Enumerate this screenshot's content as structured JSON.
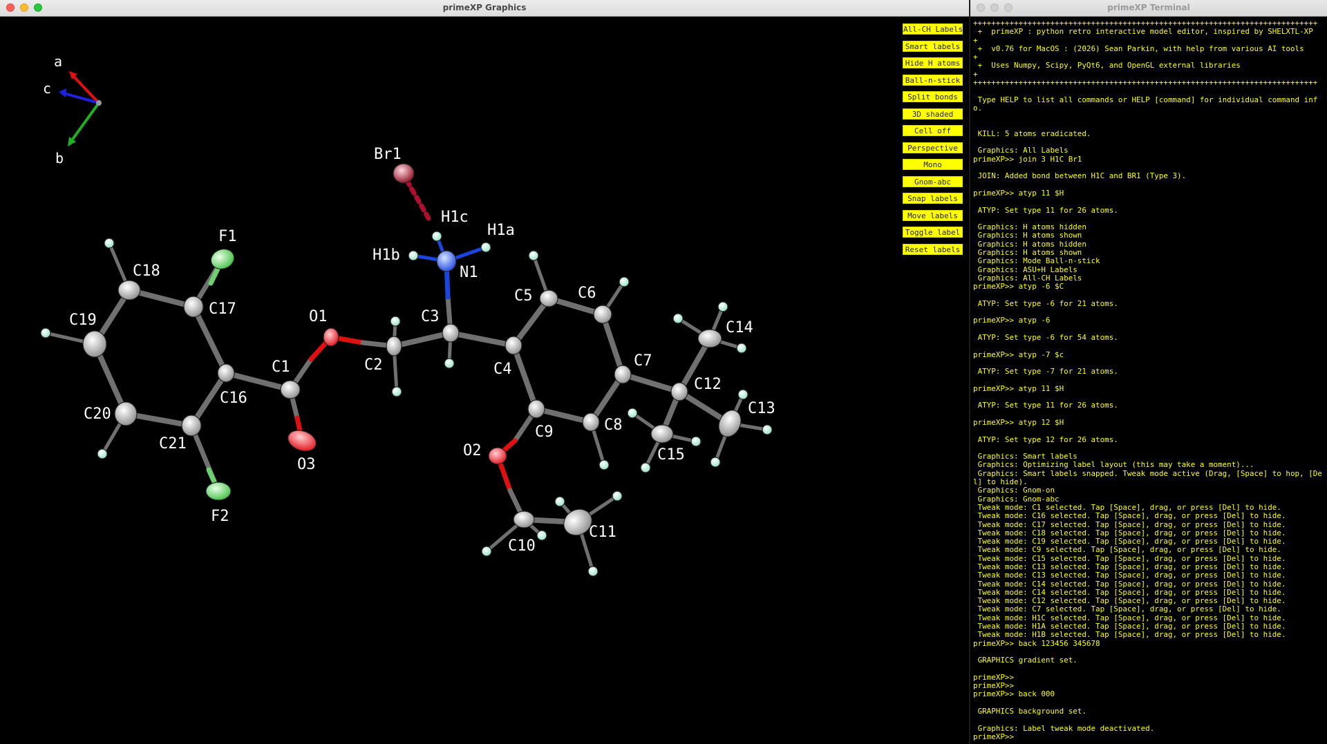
{
  "graphics_window": {
    "title": "primeXP Graphics",
    "axes": {
      "a": "a",
      "b": "b",
      "c": "c"
    },
    "buttons": [
      "All-CH Labels",
      "Smart labels",
      "Hide H atoms",
      "Ball-n-stick",
      "Split bonds",
      "3D shaded",
      "Cell off",
      "Perspective",
      "Mono",
      "Gnom-abc",
      "Snap labels",
      "Move labels",
      "Toggle label",
      "Reset labels"
    ],
    "atom_labels": {
      "Br1": "Br1",
      "H1c": "H1c",
      "H1a": "H1a",
      "H1b": "H1b",
      "N1": "N1",
      "F1": "F1",
      "F2": "F2",
      "O1": "O1",
      "O2": "O2",
      "O3": "O3",
      "C1": "C1",
      "C2": "C2",
      "C3": "C3",
      "C4": "C4",
      "C5": "C5",
      "C6": "C6",
      "C7": "C7",
      "C8": "C8",
      "C9": "C9",
      "C10": "C10",
      "C11": "C11",
      "C12": "C12",
      "C13": "C13",
      "C14": "C14",
      "C15": "C15",
      "C16": "C16",
      "C17": "C17",
      "C18": "C18",
      "C19": "C19",
      "C20": "C20",
      "C21": "C21"
    },
    "colors": {
      "background": "#000000",
      "carbon": "#e8e8e8",
      "oxygen": "#ff2a2a",
      "nitrogen": "#2a5cff",
      "fluorine": "#8aff8a",
      "bromine": "#a8142a",
      "hydrogen": "#b8ffe8",
      "bond": "#707070"
    }
  },
  "terminal_window": {
    "title": "primeXP Terminal",
    "lines": [
      "++++++++++++++++++++++++++++++++++++++++++++++++++++++++++++++++++++++++++++",
      " +  primeXP : python retro interactive model editor, inspired by SHELXTL-XP  +",
      " +  v0.76 for MacOS : (2026) Sean Parkin, with help from various AI tools    +",
      " +  Uses Numpy, Scipy, PyQt6, and OpenGL external libraries                  +",
      "++++++++++++++++++++++++++++++++++++++++++++++++++++++++++++++++++++++++++++",
      "",
      " Type HELP to list all commands or HELP [command] for individual command info.",
      "",
      "",
      " KILL: 5 atoms eradicated.",
      "",
      " Graphics: All Labels",
      "primeXP>> join 3 H1C Br1",
      "",
      " JOIN: Added bond between H1C and BR1 (Type 3).",
      "",
      "primeXP>> atyp 11 $H",
      "",
      " ATYP: Set type 11 for 26 atoms.",
      "",
      " Graphics: H atoms hidden",
      " Graphics: H atoms shown",
      " Graphics: H atoms hidden",
      " Graphics: H atoms shown",
      " Graphics: Mode Ball-n-stick",
      " Graphics: ASU+H Labels",
      " Graphics: All-CH Labels",
      "primeXP>> atyp -6 $C",
      "",
      " ATYP: Set type -6 for 21 atoms.",
      "",
      "primeXP>> atyp -6",
      "",
      " ATYP: Set type -6 for 54 atoms.",
      "",
      "primeXP>> atyp -7 $c",
      "",
      " ATYP: Set type -7 for 21 atoms.",
      "",
      "primeXP>> atyp 11 $H",
      "",
      " ATYP: Set type 11 for 26 atoms.",
      "",
      "primeXP>> atyp 12 $H",
      "",
      " ATYP: Set type 12 for 26 atoms.",
      "",
      " Graphics: Smart labels",
      " Graphics: Optimizing label layout (this may take a moment)...",
      " Graphics: Smart labels snapped. Tweak mode active (Drag, [Space] to hop, [Del] to hide).",
      " Graphics: Gnom-on",
      " Graphics: Gnom-abc",
      " Tweak mode: C1 selected. Tap [Space], drag, or press [Del] to hide.",
      " Tweak mode: C16 selected. Tap [Space], drag, or press [Del] to hide.",
      " Tweak mode: C17 selected. Tap [Space], drag, or press [Del] to hide.",
      " Tweak mode: C18 selected. Tap [Space], drag, or press [Del] to hide.",
      " Tweak mode: C19 selected. Tap [Space], drag, or press [Del] to hide.",
      " Tweak mode: C9 selected. Tap [Space], drag, or press [Del] to hide.",
      " Tweak mode: C15 selected. Tap [Space], drag, or press [Del] to hide.",
      " Tweak mode: C13 selected. Tap [Space], drag, or press [Del] to hide.",
      " Tweak mode: C13 selected. Tap [Space], drag, or press [Del] to hide.",
      " Tweak mode: C14 selected. Tap [Space], drag, or press [Del] to hide.",
      " Tweak mode: C14 selected. Tap [Space], drag, or press [Del] to hide.",
      " Tweak mode: C12 selected. Tap [Space], drag, or press [Del] to hide.",
      " Tweak mode: C7 selected. Tap [Space], drag, or press [Del] to hide.",
      " Tweak mode: H1C selected. Tap [Space], drag, or press [Del] to hide.",
      " Tweak mode: H1A selected. Tap [Space], drag, or press [Del] to hide.",
      " Tweak mode: H1B selected. Tap [Space], drag, or press [Del] to hide.",
      "primeXP>> back 123456 345678",
      "",
      " GRAPHICS gradient set.",
      "",
      "primeXP>>",
      "primeXP>>",
      "primeXP>> back 000",
      "",
      " GRAPHICS background set.",
      "",
      " Graphics: Label tweak mode deactivated.",
      "primeXP>>"
    ]
  }
}
